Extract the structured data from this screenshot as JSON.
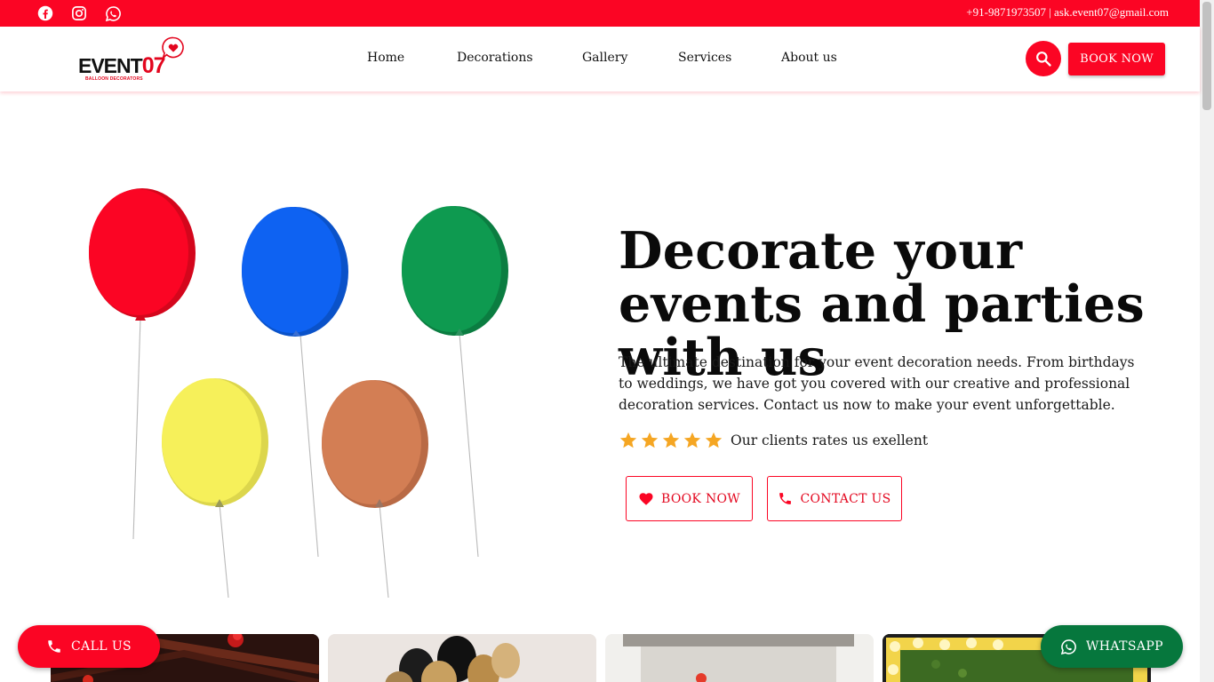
{
  "topbar": {
    "contact": "+91-9871973507 | ask.event07@gmail.com",
    "social_icons": [
      "facebook-icon",
      "instagram-icon",
      "whatsapp-icon"
    ],
    "color": "#fb0524"
  },
  "header": {
    "logo_word": "EVENT",
    "logo_number": "07",
    "logo_subtitle": "BALLOON DECORATORS",
    "nav": [
      "Home",
      "Decorations",
      "Gallery",
      "Services",
      "About us"
    ],
    "search_icon": "search-icon",
    "book_label": "BOOK NOW"
  },
  "hero": {
    "title": "Decorate your events and parties with us",
    "description": "The ultimate destination for your event decoration needs. From birthdays to weddings, we have got you covered with our creative and professional decoration services. Contact us now to make your event unforgettable.",
    "rating_stars": 5,
    "rating_text": "Our clients rates us exellent",
    "book_label": "BOOK NOW",
    "contact_label": "CONTACT US",
    "balloon_colors": [
      "#fb0524",
      "#0e62f2",
      "#0e9a50",
      "#f6f05a",
      "#d37e54"
    ]
  },
  "floating": {
    "call_label": "CALL US",
    "whatsapp_label": "WHATSAPP"
  },
  "colors": {
    "accent": "#fb0524",
    "whatsapp": "#06773d",
    "star": "#f5a623"
  }
}
